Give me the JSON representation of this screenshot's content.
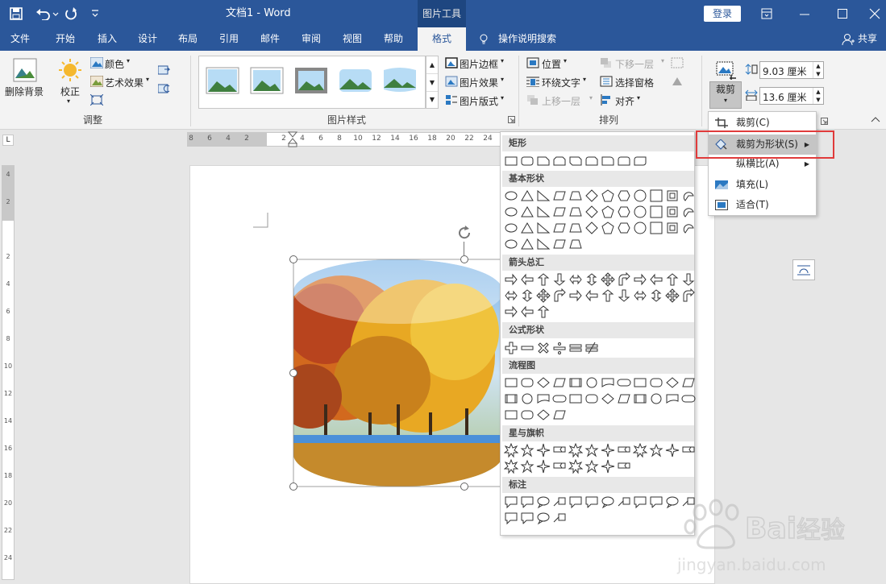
{
  "titlebar": {
    "doc_title": "文档1 - Word",
    "context_tab": "图片工具",
    "login_label": "登录",
    "quick_access": [
      "save-icon",
      "undo-icon",
      "redo-icon",
      "customize-icon"
    ],
    "window_controls": [
      "ribbon-display-icon",
      "minimize-icon",
      "maximize-icon",
      "close-icon"
    ]
  },
  "tabs": [
    "文件",
    "开始",
    "插入",
    "设计",
    "布局",
    "引用",
    "邮件",
    "审阅",
    "视图",
    "帮助",
    "格式"
  ],
  "active_tab": "格式",
  "tell_me": "操作说明搜索",
  "share_label": "共享",
  "ribbon": {
    "adjust": {
      "label": "调整",
      "remove_bg": "删除背景",
      "correct": "校正",
      "color": "颜色",
      "artistic": "艺术效果"
    },
    "styles": {
      "label": "图片样式",
      "border": "图片边框",
      "effects": "图片效果",
      "layout": "图片版式"
    },
    "arrange": {
      "label": "排列",
      "position": "位置",
      "wrap": "环绕文字",
      "forward": "上移一层",
      "backward": "下移一层",
      "selection_pane": "选择窗格",
      "align": "对齐"
    },
    "size": {
      "crop": "裁剪",
      "height_value": "9.03 厘米",
      "width_value": "13.6 厘米"
    }
  },
  "hruler_ticks": [
    "8",
    "6",
    "4",
    "2",
    "",
    "2",
    "4",
    "6",
    "8",
    "10",
    "12",
    "14",
    "16",
    "18",
    "20",
    "22",
    "24"
  ],
  "vruler_ticks": [
    "4",
    "2",
    "",
    "2",
    "4",
    "6",
    "8",
    "10",
    "12",
    "14",
    "16",
    "18",
    "20",
    "22",
    "24"
  ],
  "shapes_menu": {
    "categories": [
      {
        "name": "矩形"
      },
      {
        "name": "基本形状"
      },
      {
        "name": "箭头总汇"
      },
      {
        "name": "公式形状"
      },
      {
        "name": "流程图"
      },
      {
        "name": "星与旗帜"
      },
      {
        "name": "标注"
      }
    ]
  },
  "crop_menu": {
    "items": [
      {
        "label": "裁剪(C)",
        "icon": "crop-icon"
      },
      {
        "label": "裁剪为形状(S)",
        "icon": "crop-to-shape-icon",
        "highlighted": true
      },
      {
        "label": "纵横比(A)",
        "icon": ""
      },
      {
        "label": "填充(L)",
        "icon": "fill-icon"
      },
      {
        "label": "适合(T)",
        "icon": "fit-icon"
      }
    ]
  },
  "colors": {
    "word_blue": "#2b579a",
    "highlight_red": "#e03b3b",
    "menu_hover": "#c5c5c5"
  }
}
